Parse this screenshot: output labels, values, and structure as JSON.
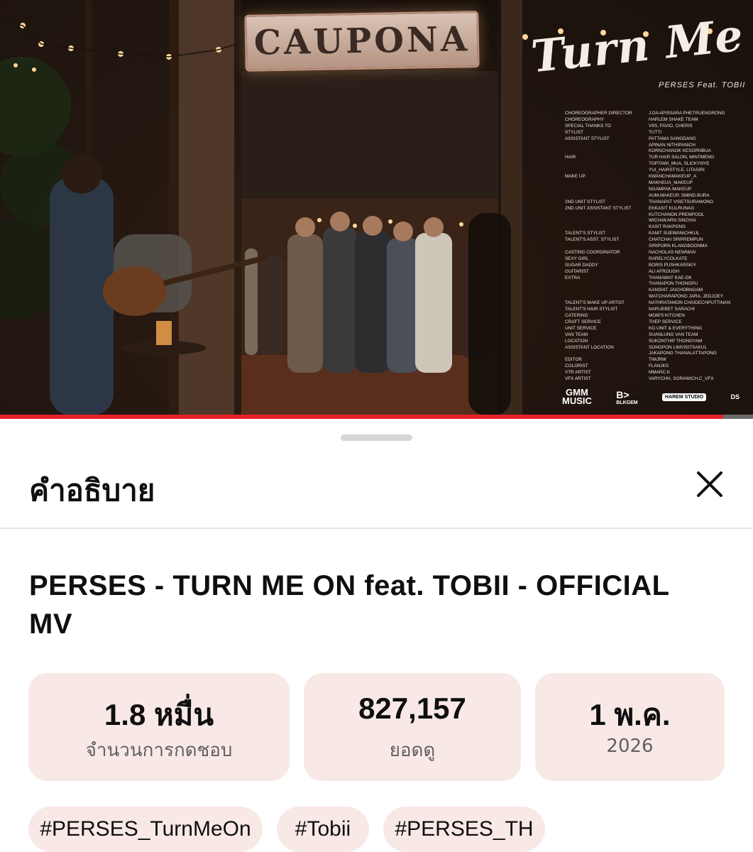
{
  "video": {
    "sign_text": "CAUPONA",
    "mv_title": "Turn Me On",
    "mv_subtitle": "PERSES Feat. TOBII",
    "credits": [
      {
        "role": "CHOREOGRAPHER DIRECTOR",
        "name": "J.DA APISSARA PHETRUENGRONG"
      },
      {
        "role": "CHOREOGRAPHY",
        "name": "HARLEM SHAKE TEAM"
      },
      {
        "role": "SPECIAL THANKS TO",
        "name": "VIIS, FAVIO, CHERIS"
      },
      {
        "role": "STYLIST",
        "name": "TUTTI"
      },
      {
        "role": "ASSISTANT STYLIST",
        "name": "PATTAMA SANGDANG"
      },
      {
        "role": "",
        "name": "APINAN NITHIPANICH"
      },
      {
        "role": "",
        "name": "KORNCHANOK KESORNBUA"
      },
      {
        "role": "HAIR",
        "name": "TUR HAIR SALON, MINTMENO"
      },
      {
        "role": "",
        "name": "TOPTAWI_MUA, SLICKYNYE"
      },
      {
        "role": "",
        "name": "YUI_HAIRSTYLE, LITASIRI"
      },
      {
        "role": "MAKE UP",
        "name": "KWANCHAMAKEUP_A"
      },
      {
        "role": "",
        "name": "MAKHEUA_MAKEUP"
      },
      {
        "role": "",
        "name": "NGAMPAK.MAKEUP"
      },
      {
        "role": "",
        "name": "AUM.MAKEUP, SMIND.BURA"
      },
      {
        "role": "2ND UNIT STYLIST",
        "name": "THANAPAT VISETSURAWONG"
      },
      {
        "role": "2ND UNIT ASSISTANT STYLIST",
        "name": "EKKASIT KULRUNAG"
      },
      {
        "role": "",
        "name": "KUTCHANON PREMPOOL"
      },
      {
        "role": "",
        "name": "WICHAKARN SINCHAI"
      },
      {
        "role": "",
        "name": "KASIT RAKPONG"
      },
      {
        "role": "TALENT'S STYLIST",
        "name": "KANIT SUEWANICHKUL"
      },
      {
        "role": "TALENT'S ASST. STYLIST",
        "name": "CHATCHAI SRIPREMPUN"
      },
      {
        "role": "",
        "name": "SIRIPORN KLANGBOONMA"
      },
      {
        "role": "CASTING COORDINATOR",
        "name": "NACHOLAS NEWMAN"
      },
      {
        "role": "SEXY GIRL",
        "name": "RARELYCOLKATE"
      },
      {
        "role": "SUGAR DADDY",
        "name": "BORIS PUSHKARSKIY"
      },
      {
        "role": "GUITARIST",
        "name": "ALI AFROUGH"
      },
      {
        "role": "EXTRA",
        "name": "THANAWAT KAE-OK"
      },
      {
        "role": "",
        "name": "THANAPON THONGPU"
      },
      {
        "role": "",
        "name": "KANSHIT JAICHOBNGAM"
      },
      {
        "role": "",
        "name": "WATCHARAPONG JARA, JEDJOEY"
      },
      {
        "role": "TALENT'S MAKE UP ARTIST",
        "name": "NATHRATAMON CHAIDECHPUTTINAN"
      },
      {
        "role": "TALENT'S HAIR STYLIST",
        "name": "NARUEBET SARACHI"
      },
      {
        "role": "CATERING",
        "name": "MOM'S KITCHEN"
      },
      {
        "role": "CRAFT SERVICE",
        "name": "THEP SERVICE"
      },
      {
        "role": "UNIT SERVICE",
        "name": "KO UNIT & EVERYTHING"
      },
      {
        "role": "VAN TEAM",
        "name": "SUANLUNG VAN TEAM"
      },
      {
        "role": "LOCATION",
        "name": "SUKONTHIP THONGYAM"
      },
      {
        "role": "ASSISTANT LOCATION",
        "name": "SONGPON LIMVISITSAKUL"
      },
      {
        "role": "",
        "name": "JAKAPONG THANALATTAPONG"
      },
      {
        "role": "EDITOR",
        "name": "TIMJRW"
      },
      {
        "role": "COLORIST",
        "name": "FLANJKS"
      },
      {
        "role": "VTR ARTIST",
        "name": "MMARC.K"
      },
      {
        "role": "VFX ARTIST",
        "name": "VARYCHH, SORAWICH.C_VFX"
      }
    ],
    "logos": {
      "gmm_line1": "GMM",
      "gmm_line2": "MUSIC",
      "bk": "B>",
      "bk_sub": "BLKGEM",
      "hm": "HAREM STUDIO",
      "small": "DS"
    },
    "progress": 0.96,
    "colors": {
      "progress": "#e8202c",
      "track": "#6b6b6b"
    }
  },
  "sheet": {
    "title": "คำอธิบาย",
    "close_icon": "close-icon",
    "video_title": "PERSES - TURN ME ON feat. TOBII - OFFICIAL MV",
    "stats": [
      {
        "value": "1.8 หมื่น",
        "label": "จำนวนการกดชอบ"
      },
      {
        "value": "827,157",
        "label": "ยอดดู"
      },
      {
        "value": "1 พ.ค.",
        "label": "2026"
      }
    ],
    "hashtags": [
      "#PERSES_TurnMeOn",
      "#Tobii",
      "#PERSES_TH"
    ],
    "colors": {
      "chip_bg": "#f8e9e6",
      "text": "#0f0f0f",
      "secondary": "#606060"
    }
  }
}
